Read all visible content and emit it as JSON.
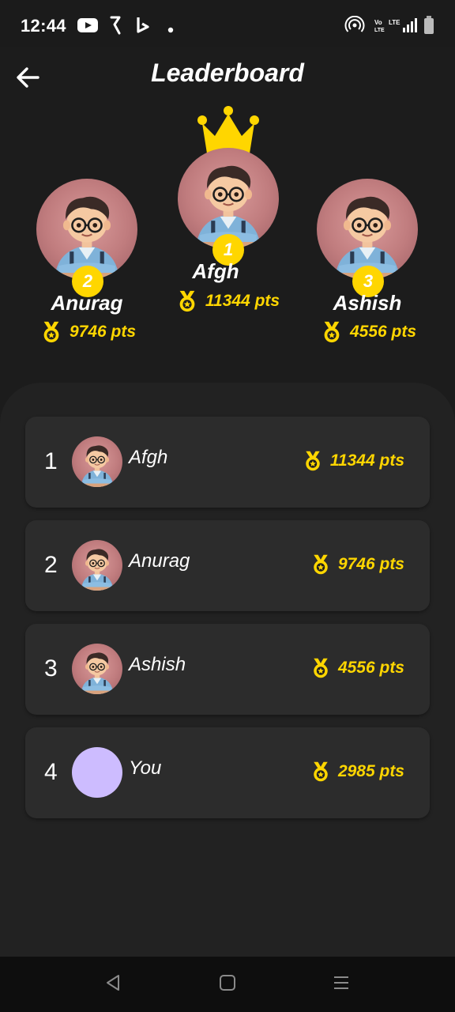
{
  "status_bar": {
    "time": "12:44",
    "icons": [
      "youtube-icon",
      "app-icon-k",
      "bing-icon",
      "dot-icon",
      "hotspot-icon",
      "volte-lte-icon",
      "signal-icon",
      "battery-icon"
    ]
  },
  "header": {
    "title": "Leaderboard",
    "back_icon": "arrow-left-icon"
  },
  "podium": {
    "first": {
      "rank": "1",
      "name": "Afgh",
      "points": "11344 pts"
    },
    "second": {
      "rank": "2",
      "name": "Anurag",
      "points": "9746 pts"
    },
    "third": {
      "rank": "3",
      "name": "Ashish",
      "points": "4556 pts"
    },
    "crown_icon": "crown-icon",
    "medal_icon": "medal-icon"
  },
  "list": [
    {
      "rank": "1",
      "name": "Afgh",
      "points": "11344 pts",
      "avatar": "cartoon-boy-avatar"
    },
    {
      "rank": "2",
      "name": "Anurag",
      "points": "9746 pts",
      "avatar": "cartoon-boy-avatar"
    },
    {
      "rank": "3",
      "name": "Ashish",
      "points": "4556 pts",
      "avatar": "cartoon-boy-avatar"
    },
    {
      "rank": "4",
      "name": "You",
      "points": "2985 pts",
      "avatar": "plain-lavender-circle"
    }
  ],
  "nav_bar": {
    "buttons": [
      "back-triangle-icon",
      "home-square-icon",
      "menu-lines-icon"
    ]
  },
  "colors": {
    "background": "#1c1c1c",
    "panel": "#222222",
    "card": "#2c2c2c",
    "accent_gold": "#ffd600",
    "you_avatar": "#cdbcff"
  }
}
